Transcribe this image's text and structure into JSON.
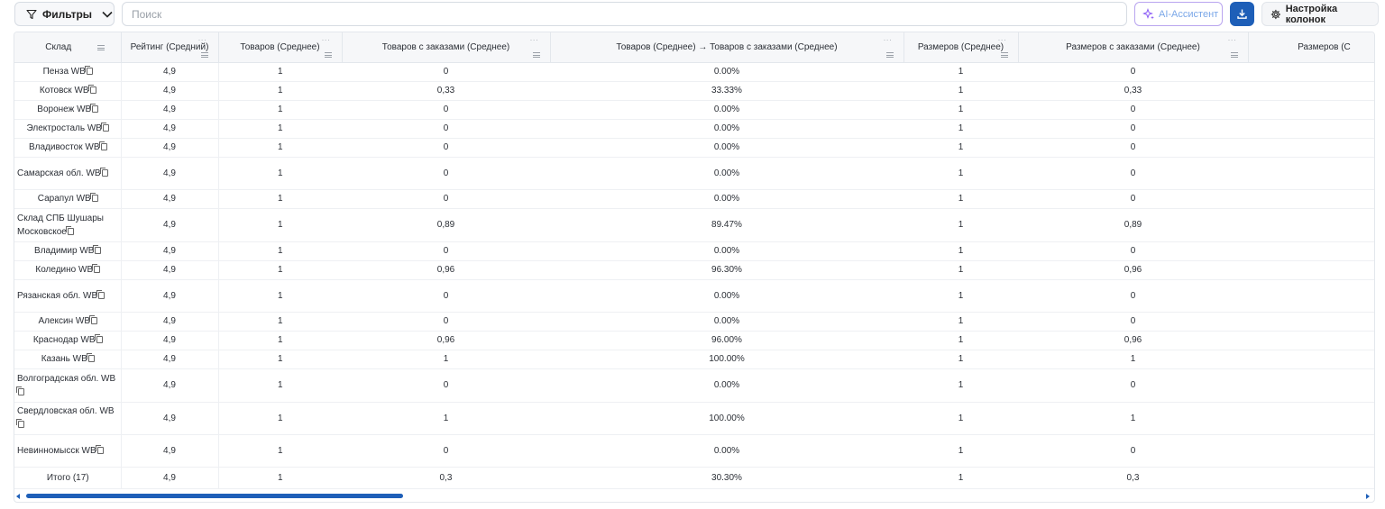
{
  "toolbar": {
    "filters_label": "Фильтры",
    "search_placeholder": "Поиск",
    "ai_label": "AI-Ассистент",
    "columns_label": "Настройка колонок"
  },
  "table": {
    "columns": [
      "Склад",
      "Рейтинг (Средний)",
      "Товаров (Среднее)",
      "Товаров с заказами (Среднее)",
      "Товаров (Среднее) → Товаров с заказами (Среднее)",
      "Размеров (Среднее)",
      "Размеров с заказами (Среднее)",
      "Размеров (С"
    ],
    "rows": [
      {
        "wh": "Пенза WB",
        "rating": "4,9",
        "goods": "1",
        "goods_orders": "0",
        "conv": "0.00%",
        "sizes": "1",
        "sizes_orders": "0"
      },
      {
        "wh": "Котовск WB",
        "rating": "4,9",
        "goods": "1",
        "goods_orders": "0,33",
        "conv": "33.33%",
        "sizes": "1",
        "sizes_orders": "0,33"
      },
      {
        "wh": "Воронеж WB",
        "rating": "4,9",
        "goods": "1",
        "goods_orders": "0",
        "conv": "0.00%",
        "sizes": "1",
        "sizes_orders": "0"
      },
      {
        "wh": "Электросталь WB",
        "rating": "4,9",
        "goods": "1",
        "goods_orders": "0",
        "conv": "0.00%",
        "sizes": "1",
        "sizes_orders": "0"
      },
      {
        "wh": "Владивосток WB",
        "rating": "4,9",
        "goods": "1",
        "goods_orders": "0",
        "conv": "0.00%",
        "sizes": "1",
        "sizes_orders": "0"
      },
      {
        "wh": "Самарская обл. WB",
        "rating": "4,9",
        "goods": "1",
        "goods_orders": "0",
        "conv": "0.00%",
        "sizes": "1",
        "sizes_orders": "0"
      },
      {
        "wh": "Сарапул WB",
        "rating": "4,9",
        "goods": "1",
        "goods_orders": "0",
        "conv": "0.00%",
        "sizes": "1",
        "sizes_orders": "0"
      },
      {
        "wh": "Склад СПБ Шушары Московское",
        "rating": "4,9",
        "goods": "1",
        "goods_orders": "0,89",
        "conv": "89.47%",
        "sizes": "1",
        "sizes_orders": "0,89"
      },
      {
        "wh": "Владимир WB",
        "rating": "4,9",
        "goods": "1",
        "goods_orders": "0",
        "conv": "0.00%",
        "sizes": "1",
        "sizes_orders": "0"
      },
      {
        "wh": "Коледино WB",
        "rating": "4,9",
        "goods": "1",
        "goods_orders": "0,96",
        "conv": "96.30%",
        "sizes": "1",
        "sizes_orders": "0,96"
      },
      {
        "wh": "Рязанская обл. WB",
        "rating": "4,9",
        "goods": "1",
        "goods_orders": "0",
        "conv": "0.00%",
        "sizes": "1",
        "sizes_orders": "0"
      },
      {
        "wh": "Алексин WB",
        "rating": "4,9",
        "goods": "1",
        "goods_orders": "0",
        "conv": "0.00%",
        "sizes": "1",
        "sizes_orders": "0"
      },
      {
        "wh": "Краснодар WB",
        "rating": "4,9",
        "goods": "1",
        "goods_orders": "0,96",
        "conv": "96.00%",
        "sizes": "1",
        "sizes_orders": "0,96"
      },
      {
        "wh": "Казань WB",
        "rating": "4,9",
        "goods": "1",
        "goods_orders": "1",
        "conv": "100.00%",
        "sizes": "1",
        "sizes_orders": "1"
      },
      {
        "wh": "Волгоградская обл. WB",
        "rating": "4,9",
        "goods": "1",
        "goods_orders": "0",
        "conv": "0.00%",
        "sizes": "1",
        "sizes_orders": "0"
      },
      {
        "wh": "Свердловская обл. WB",
        "rating": "4,9",
        "goods": "1",
        "goods_orders": "1",
        "conv": "100.00%",
        "sizes": "1",
        "sizes_orders": "1"
      },
      {
        "wh": "Невинномысск WB",
        "rating": "4,9",
        "goods": "1",
        "goods_orders": "0",
        "conv": "0.00%",
        "sizes": "1",
        "sizes_orders": "0"
      }
    ],
    "total": {
      "wh": "Итого (17)",
      "rating": "4,9",
      "goods": "1",
      "goods_orders": "0,3",
      "conv": "30.30%",
      "sizes": "1",
      "sizes_orders": "0,3"
    }
  },
  "colors": {
    "accent": "#1e5fb8",
    "ai_border": "#b9a5ef"
  }
}
